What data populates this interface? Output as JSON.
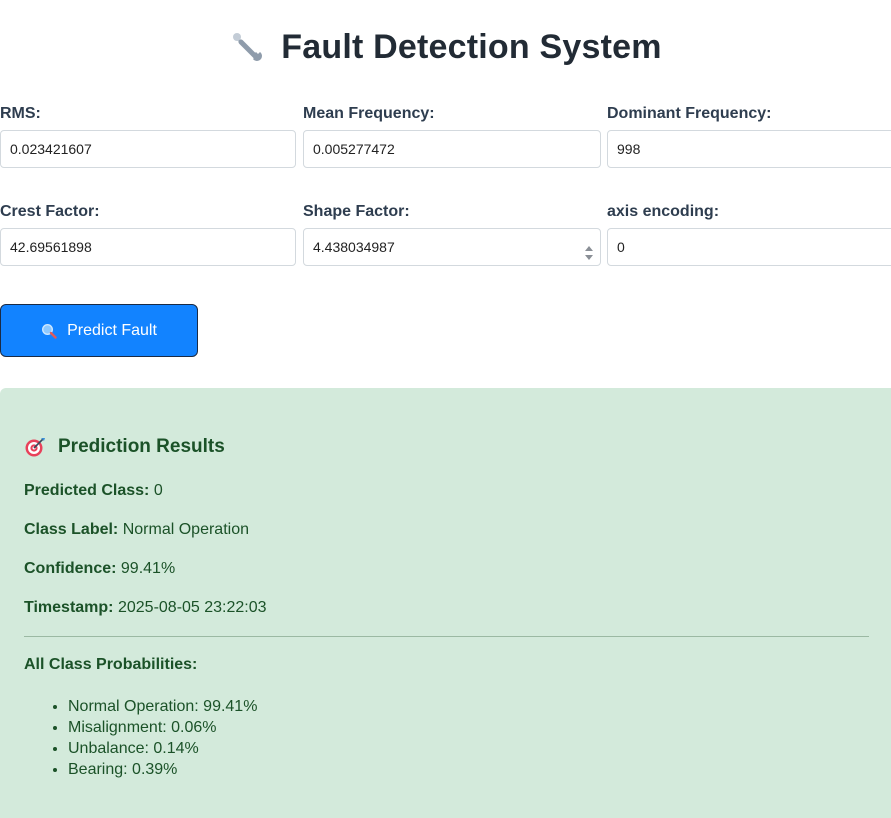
{
  "header": {
    "title": "Fault Detection System",
    "icon": "wrench-icon"
  },
  "form": {
    "fields": [
      {
        "label": "RMS:",
        "value": "0.023421607"
      },
      {
        "label": "Mean Frequency:",
        "value": "0.005277472"
      },
      {
        "label": "Dominant Frequency:",
        "value": "998"
      },
      {
        "label": "Crest Factor:",
        "value": "42.69561898"
      },
      {
        "label": "Shape Factor:",
        "value": "4.438034987"
      },
      {
        "label": "axis encoding:",
        "value": "0"
      }
    ],
    "submit_label": "Predict Fault",
    "submit_icon": "magnifier-icon"
  },
  "results": {
    "title": "Prediction Results",
    "icon": "target-icon",
    "predicted_class_label": "Predicted Class:",
    "predicted_class_value": "0",
    "class_label_label": "Class Label:",
    "class_label_value": "Normal Operation",
    "confidence_label": "Confidence:",
    "confidence_value": "99.41%",
    "timestamp_label": "Timestamp:",
    "timestamp_value": "2025-08-05 23:22:03",
    "probabilities_title": "All Class Probabilities:",
    "probabilities": [
      "Normal Operation: 99.41%",
      "Misalignment: 0.06%",
      "Unbalance: 0.14%",
      "Bearing: 0.39%"
    ]
  },
  "colors": {
    "accent": "#1283ff",
    "success_bg": "#d3eadb",
    "success_text": "#1b5228"
  }
}
